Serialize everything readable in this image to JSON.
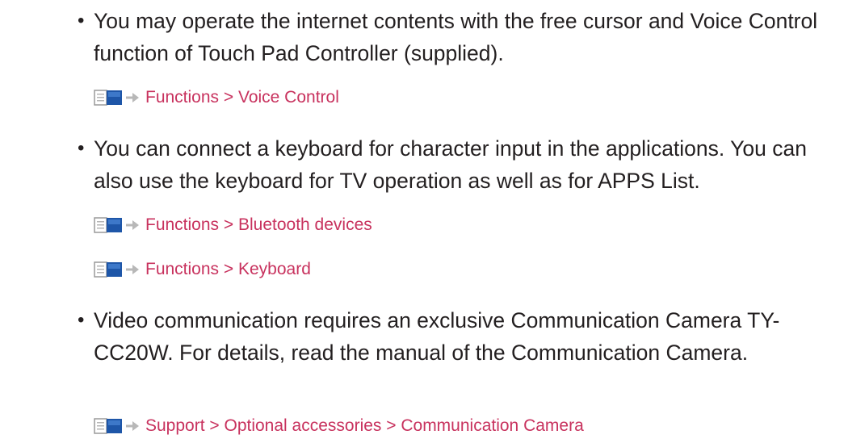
{
  "items": [
    {
      "bullet": "•",
      "text": "You may operate the internet contents with the free cursor and Voice Control function of Touch Pad Controller (supplied).",
      "links": [
        {
          "text": "Functions > Voice Control",
          "icon": "book-icon"
        }
      ]
    },
    {
      "bullet": "•",
      "text": "You can connect a keyboard for character input in the applications. You can also use the keyboard for TV operation as well as for APPS List.",
      "links": [
        {
          "text": "Functions > Bluetooth devices",
          "icon": "book-icon"
        },
        {
          "text": "Functions > Keyboard",
          "icon": "book-icon"
        }
      ]
    },
    {
      "bullet": "•",
      "text": "Video communication requires an exclusive Communication Camera TY-CC20W. For details, read the manual of the Communication Camera.",
      "links": [
        {
          "text": "Support > Optional accessories > Communication Camera",
          "icon": "book-icon"
        }
      ]
    }
  ],
  "colors": {
    "text": "#231f20",
    "link": "#c8325e",
    "icon_blue": "#1e56a8",
    "icon_gray": "#9a9a9a"
  }
}
